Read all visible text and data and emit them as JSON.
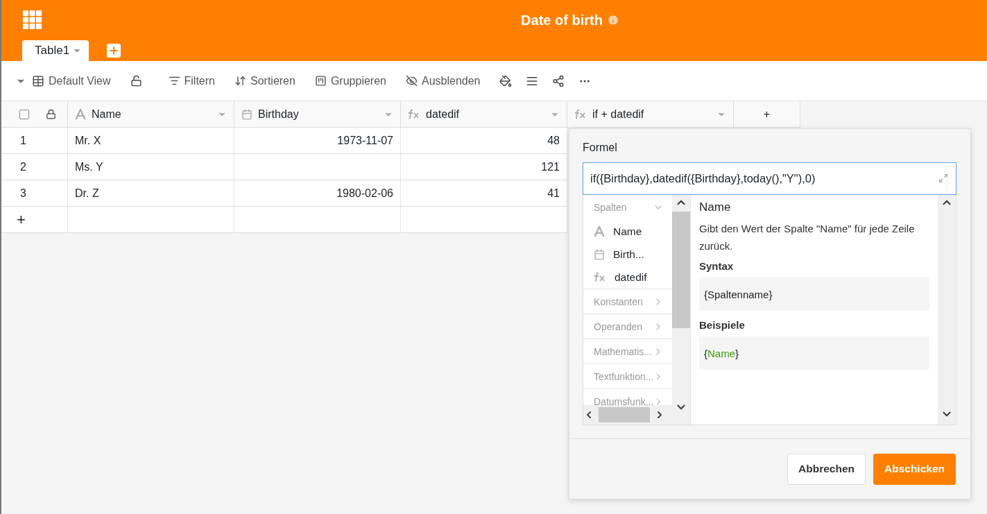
{
  "header": {
    "title": "Date of birth"
  },
  "select_all": {
    "checked": false
  },
  "tabs": [
    {
      "label": "Table1",
      "selected": true
    }
  ],
  "toolbar": {
    "view": "Default View",
    "items": [
      {
        "kind": "filter",
        "label": "Filtern"
      },
      {
        "kind": "sort",
        "label": "Sortieren"
      },
      {
        "kind": "group",
        "label": "Gruppieren"
      },
      {
        "kind": "hide",
        "label": "Ausblenden"
      },
      {
        "kind": "paint"
      },
      {
        "kind": "height"
      },
      {
        "kind": "share"
      },
      {
        "kind": "more"
      }
    ]
  },
  "table": {
    "columns": [
      {
        "kind": "text",
        "label": "Name"
      },
      {
        "kind": "date",
        "label": "Birthday"
      },
      {
        "kind": "formula",
        "label": "datedif"
      },
      {
        "kind": "formula",
        "label": "if + datedif"
      }
    ],
    "add_column": "+",
    "rows": [
      {
        "number": "1",
        "cells": [
          "Mr. X",
          "1973-11-07",
          "48"
        ]
      },
      {
        "number": "2",
        "cells": [
          "Ms. Y",
          "",
          "121"
        ]
      },
      {
        "number": "3",
        "cells": [
          "Dr. Z",
          "1980-02-06",
          "41"
        ]
      }
    ],
    "add_row": "+"
  },
  "formula_dialog": {
    "label": "Formel",
    "value": "if({Birthday},datedif({Birthday},today(),\"Y\"),0)",
    "sections": [
      {
        "label": "Spalten",
        "expanded": true,
        "items": [
          {
            "kind": "text",
            "label": "Name"
          },
          {
            "kind": "date",
            "label": "Birth..."
          },
          {
            "kind": "formula",
            "label": "datedif"
          }
        ]
      },
      {
        "label": "Konstanten",
        "expanded": false
      },
      {
        "label": "Operanden",
        "expanded": false
      },
      {
        "label": "Mathematis...",
        "expanded": false
      },
      {
        "label": "Textfunktion...",
        "expanded": false
      },
      {
        "label": "Datumsfunk...",
        "expanded": false
      }
    ],
    "detail": {
      "title": "Name",
      "description": "Gibt den Wert der Spalte \"Name\" für jede Zeile zurück.",
      "syntax_label": "Syntax",
      "syntax": "{Spaltenname}",
      "examples_label": "Beispiele",
      "example": {
        "before": "{",
        "highlight": "Name",
        "after": "}"
      }
    },
    "buttons": [
      {
        "kind": "secondary",
        "label": "Abbrechen"
      },
      {
        "kind": "primary",
        "label": "Abschicken"
      }
    ]
  }
}
